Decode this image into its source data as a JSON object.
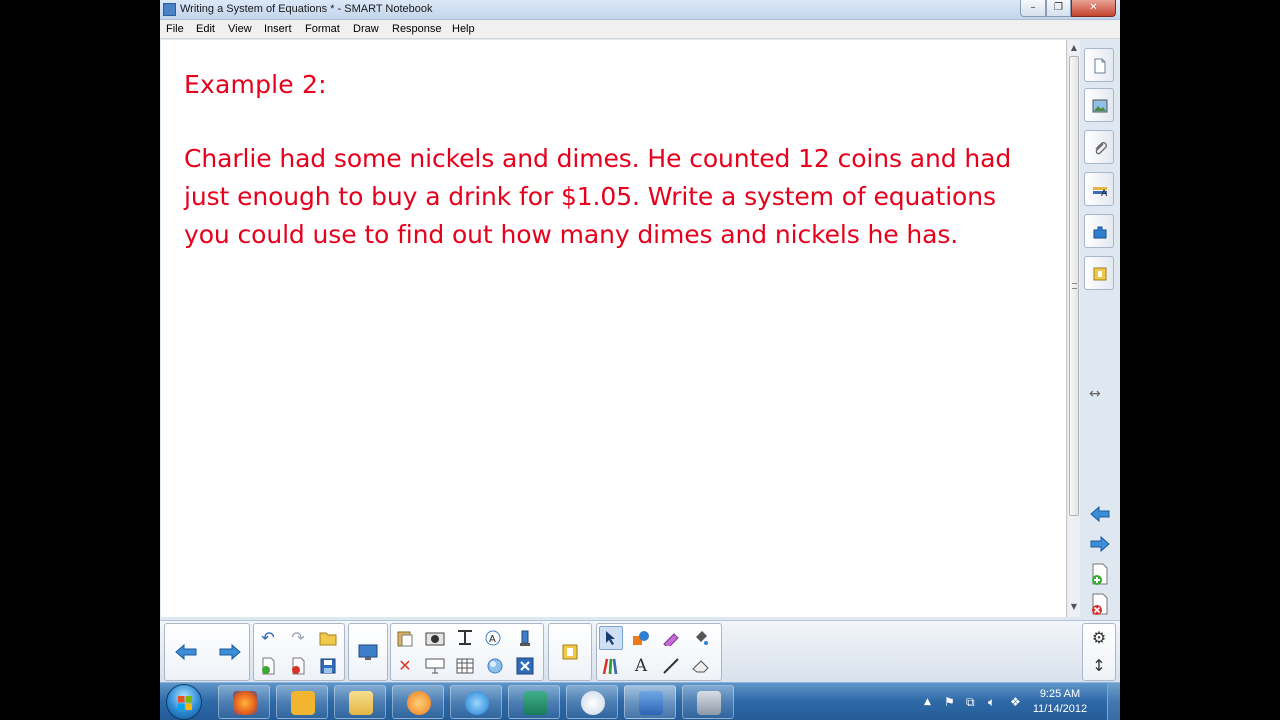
{
  "window": {
    "title": "Writing a System of Equations * - SMART Notebook",
    "min_symbol": "–",
    "max_symbol": "❐",
    "close_symbol": "✕"
  },
  "menu": [
    "File",
    "Edit",
    "View",
    "Insert",
    "Format",
    "Draw",
    "Response",
    "Help"
  ],
  "page": {
    "heading": "Example 2:",
    "problem_lines": [
      "Charlie had some nickels and dimes. He counted 12 coins and had",
      "just enough to buy a drink for $1.05. Write a system of equations",
      "you could use to find out how many dimes and nickels he has."
    ],
    "text_color": "#e6001c"
  },
  "sidebar": {
    "tabs": [
      "page-sorter-icon",
      "gallery-icon",
      "attachments-icon",
      "properties-icon",
      "addons-icon",
      "lesson-activity-icon"
    ],
    "resize_glyph": "↔"
  },
  "toolbar": {
    "groups": [
      "navigation",
      "undo-redo-open",
      "screen-capture",
      "page-tools",
      "response",
      "drawing-tools"
    ]
  },
  "taskbar": {
    "apps": [
      "firefox-icon",
      "outlook-icon",
      "explorer-icon",
      "media-player-icon",
      "internet-explorer-icon",
      "publisher-icon",
      "paint-icon",
      "smart-notebook-icon",
      "smart-tools-icon"
    ],
    "tray_arrow": "▲",
    "clock_time": "9:25 AM",
    "clock_date": "11/14/2012"
  }
}
